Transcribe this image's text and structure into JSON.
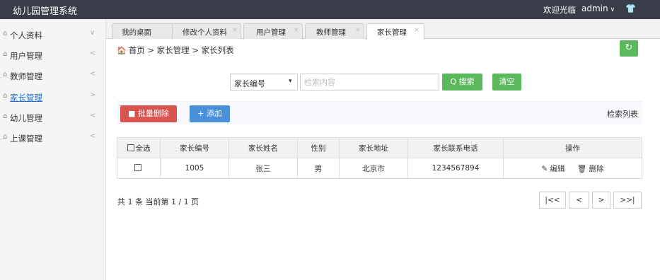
{
  "app": {
    "title": "幼儿园管理系统"
  },
  "header": {
    "welcome": "欢迎光临",
    "username": "admin",
    "caret": "∨",
    "shirt_glyph": "👕"
  },
  "sidebar": {
    "items": [
      {
        "label": "个人资料",
        "arrow": "∨"
      },
      {
        "label": "用户管理",
        "arrow": "<"
      },
      {
        "label": "教师管理",
        "arrow": "<"
      },
      {
        "label": "家长管理",
        "arrow": ">"
      },
      {
        "label": "幼儿管理",
        "arrow": "<"
      },
      {
        "label": "上课管理",
        "arrow": "<"
      }
    ]
  },
  "tabs": [
    {
      "label": "我的桌面",
      "close": ""
    },
    {
      "label": "修改个人资料",
      "close": "×"
    },
    {
      "label": "用户管理",
      "close": "×"
    },
    {
      "label": "教师管理",
      "close": "×"
    },
    {
      "label": "家长管理",
      "close": "×"
    }
  ],
  "breadcrumb": {
    "home": "首页",
    "sep1": ">",
    "section": "家长管理",
    "sep2": ">",
    "page": "家长列表"
  },
  "refresh_glyph": "↻",
  "search": {
    "field": "家长编号",
    "caret": "▾",
    "placeholder": "检索内容",
    "search_label": "Q 搜索",
    "clear_label": "清空"
  },
  "toolbar": {
    "delete_label": "■ 批量删除",
    "add_label": "+ 添加",
    "list_label": "检索列表"
  },
  "table": {
    "select_all": "全选",
    "headers": [
      "家长编号",
      "家长姓名",
      "性别",
      "家长地址",
      "家长联系电话",
      "操作"
    ],
    "rows": [
      {
        "id": "1005",
        "name": "张三",
        "gender": "男",
        "address": "北京市",
        "phone": "1234567894",
        "edit": "✎ 编辑",
        "delete": "🗑 删除"
      }
    ]
  },
  "pagination": {
    "summary": "共 1 条   当前第 1 / 1 页",
    "first": "|<<",
    "prev": "<",
    "next": ">",
    "last": ">>|"
  }
}
